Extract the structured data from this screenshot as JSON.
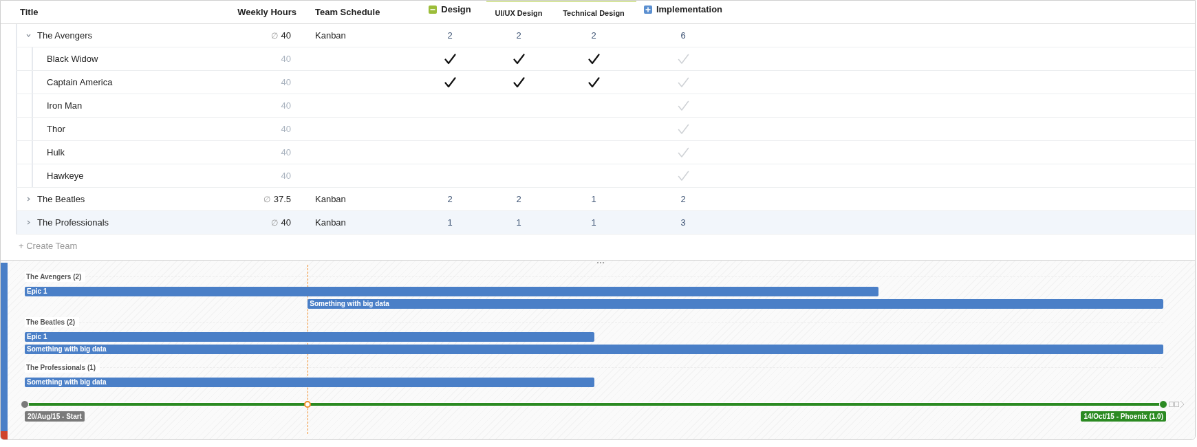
{
  "table": {
    "columns": [
      {
        "label": "Title",
        "kind": "plain"
      },
      {
        "label": "Weekly Hours",
        "kind": "plain"
      },
      {
        "label": "Team Schedule",
        "kind": "plain"
      },
      {
        "label": "Design",
        "kind": "group",
        "expanded": true
      },
      {
        "label": "UI/UX Design",
        "kind": "sub"
      },
      {
        "label": "Technical Design",
        "kind": "sub"
      },
      {
        "label": "Implementation",
        "kind": "group",
        "expanded": false
      }
    ],
    "teams": [
      {
        "name": "The Avengers",
        "expanded": true,
        "selected": false,
        "avg_symbol": "∅",
        "hours": "40",
        "schedule": "Kanban",
        "counts": [
          "2",
          "2",
          "2",
          "6"
        ],
        "members": [
          {
            "name": "Black Widow",
            "selected": false,
            "hours": "40",
            "cells": [
              {
                "checked": true
              },
              {
                "checked": true
              },
              {
                "checked": true
              },
              {
                "checked": true
              }
            ]
          },
          {
            "name": "Captain America",
            "selected": false,
            "hours": "40",
            "cells": [
              {
                "checked": true
              },
              {
                "checked": true
              },
              {
                "checked": true
              },
              {
                "checked": true
              }
            ]
          },
          {
            "name": "Iron Man",
            "selected": false,
            "hours": "40",
            "cells": [
              {
                "checked": false
              },
              {
                "checked": false
              },
              {
                "checked": false
              },
              {
                "checked": true
              }
            ]
          },
          {
            "name": "Thor",
            "selected": false,
            "hours": "40",
            "cells": [
              {
                "checked": false
              },
              {
                "checked": false
              },
              {
                "checked": false
              },
              {
                "checked": true
              }
            ]
          },
          {
            "name": "Hulk",
            "selected": false,
            "hours": "40",
            "cells": [
              {
                "checked": false
              },
              {
                "checked": false
              },
              {
                "checked": false
              },
              {
                "checked": true
              }
            ]
          },
          {
            "name": "Hawkeye",
            "selected": false,
            "hours": "40",
            "cells": [
              {
                "checked": false
              },
              {
                "checked": false
              },
              {
                "checked": false
              },
              {
                "checked": true
              }
            ]
          }
        ]
      },
      {
        "name": "The Beatles",
        "expanded": false,
        "selected": false,
        "avg_symbol": "∅",
        "hours": "37.5",
        "schedule": "Kanban",
        "counts": [
          "2",
          "2",
          "1",
          "2"
        ]
      },
      {
        "name": "The Professionals",
        "expanded": false,
        "selected": true,
        "avg_symbol": "∅",
        "hours": "40",
        "schedule": "Kanban",
        "counts": [
          "1",
          "1",
          "1",
          "3"
        ]
      }
    ],
    "create_label": "+ Create Team"
  },
  "timeline": {
    "groups": [
      {
        "title": "The Avengers (2)",
        "bars": [
          {
            "label": "Epic 1"
          },
          {
            "label": "Something with big data"
          }
        ]
      },
      {
        "title": "The Beatles (2)",
        "bars": [
          {
            "label": "Epic 1"
          },
          {
            "label": "Something with big data"
          }
        ]
      },
      {
        "title": "The Professionals (1)",
        "bars": [
          {
            "label": "Something with big data"
          }
        ]
      }
    ],
    "milestones": [
      {
        "label": "20/Aug/15 - Start",
        "color": "#7a7a7a"
      },
      {
        "label": "14/Oct/15 - Phoenix (1.0)",
        "color": "#2b8a22"
      }
    ]
  }
}
